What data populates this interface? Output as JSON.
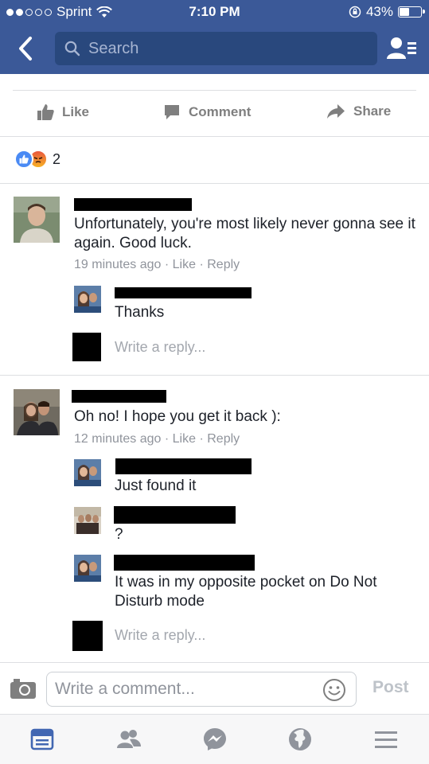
{
  "status_bar": {
    "carrier": "Sprint",
    "time": "7:10 PM",
    "battery": "43%",
    "battery_level": 0.43
  },
  "nav": {
    "search_placeholder": "Search",
    "icons": [
      "chevron-left-icon",
      "search-icon",
      "friend-requests-icon"
    ]
  },
  "post_actions": {
    "like_label": "Like",
    "comment_label": "Comment",
    "share_label": "Share"
  },
  "reactions": {
    "types": [
      "like",
      "angry"
    ],
    "count": "2"
  },
  "comments": [
    {
      "text": "Unfortunately, you're most likely never gonna see it again. Good luck.",
      "time": "19 minutes ago",
      "like": "Like",
      "reply": "Reply",
      "replies": [
        {
          "text": "Thanks"
        }
      ],
      "reply_placeholder": "Write a reply..."
    },
    {
      "text": "Oh no! I hope you get it back ):",
      "time": "12 minutes ago",
      "like": "Like",
      "reply": "Reply",
      "replies": [
        {
          "text": "Just found it"
        },
        {
          "text": "?"
        },
        {
          "text": "It was in my opposite pocket on Do Not Disturb mode"
        }
      ],
      "reply_placeholder": "Write a reply..."
    }
  ],
  "composer": {
    "placeholder": "Write a comment...",
    "post_label": "Post"
  },
  "tabbar": {
    "tabs": [
      "news-feed-icon",
      "friends-icon",
      "messenger-icon",
      "notifications-globe-icon",
      "menu-icon"
    ],
    "active": "news-feed-icon"
  },
  "colors": {
    "brand_blue": "#3b5998",
    "search_bg": "#29487d",
    "meta_gray": "#90949c",
    "active_tab": "#4267b2"
  }
}
